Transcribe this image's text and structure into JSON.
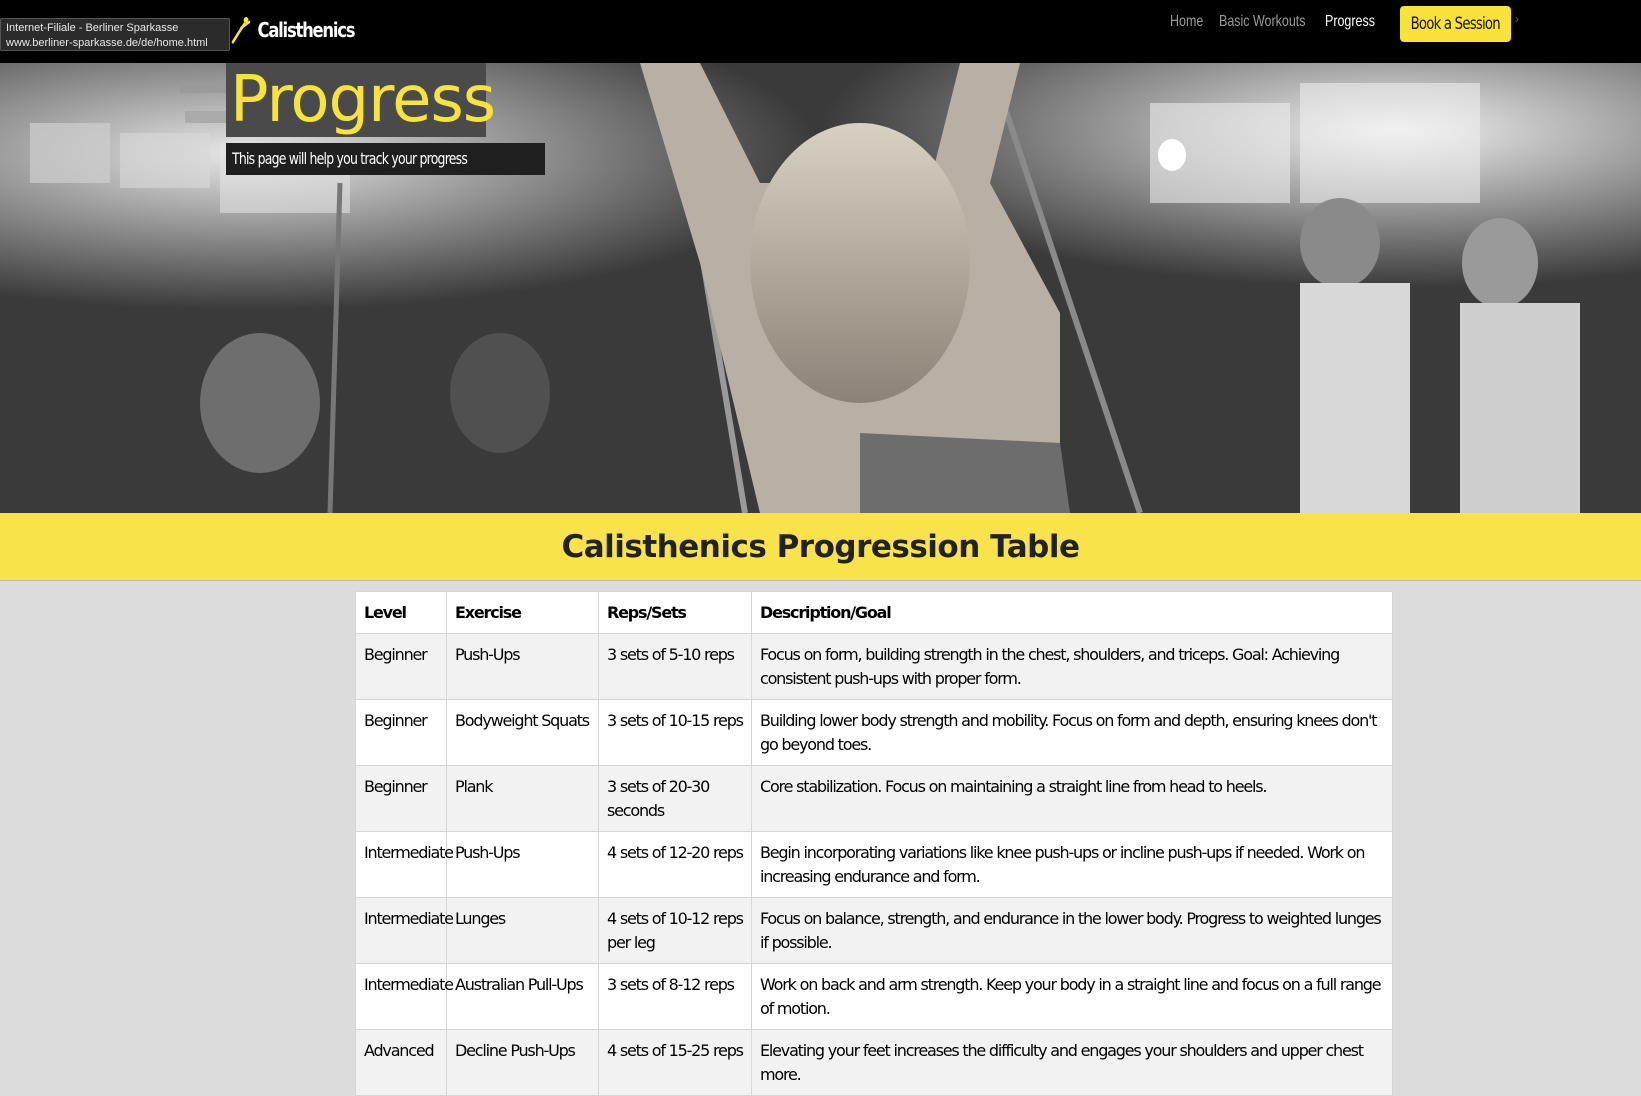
{
  "tooltip": {
    "line1": "Internet-Filiale - Berliner Sparkasse",
    "line2": "www.berliner-sparkasse.de/de/home.html"
  },
  "navbar": {
    "brand": "Calisthenics",
    "links": [
      {
        "label": "Home",
        "active": false
      },
      {
        "label": "Basic Workouts",
        "active": false
      },
      {
        "label": "Progress",
        "active": true
      }
    ],
    "cta": "Book a Session"
  },
  "hero": {
    "title": "Progress",
    "subtitle": "This page will help you track your progress"
  },
  "banner": {
    "title": "Calisthenics Progression Table"
  },
  "table": {
    "headers": [
      "Level",
      "Exercise",
      "Reps/Sets",
      "Description/Goal"
    ],
    "rows": [
      [
        "Beginner",
        "Push-Ups",
        "3 sets of 5-10 reps",
        "Focus on form, building strength in the chest, shoulders, and triceps. Goal: Achieving consistent push-ups with proper form."
      ],
      [
        "Beginner",
        "Bodyweight Squats",
        "3 sets of 10-15 reps",
        "Building lower body strength and mobility. Focus on form and depth, ensuring knees don't go beyond toes."
      ],
      [
        "Beginner",
        "Plank",
        "3 sets of 20-30 seconds",
        "Core stabilization. Focus on maintaining a straight line from head to heels."
      ],
      [
        "Intermediate",
        "Push-Ups",
        "4 sets of 12-20 reps",
        "Begin incorporating variations like knee push-ups or incline push-ups if needed. Work on increasing endurance and form."
      ],
      [
        "Intermediate",
        "Lunges",
        "4 sets of 10-12 reps per leg",
        "Focus on balance, strength, and endurance in the lower body. Progress to weighted lunges if possible."
      ],
      [
        "Intermediate",
        "Australian Pull-Ups",
        "3 sets of 8-12 reps",
        "Work on back and arm strength. Keep your body in a straight line and focus on a full range of motion."
      ],
      [
        "Advanced",
        "Decline Push-Ups",
        "4 sets of 15-25 reps",
        "Elevating your feet increases the difficulty and engages your shoulders and upper chest more."
      ]
    ]
  },
  "colors": {
    "accent": "#f8e44a",
    "nav_bg": "#000000",
    "page_bg": "#dcdcdc"
  }
}
